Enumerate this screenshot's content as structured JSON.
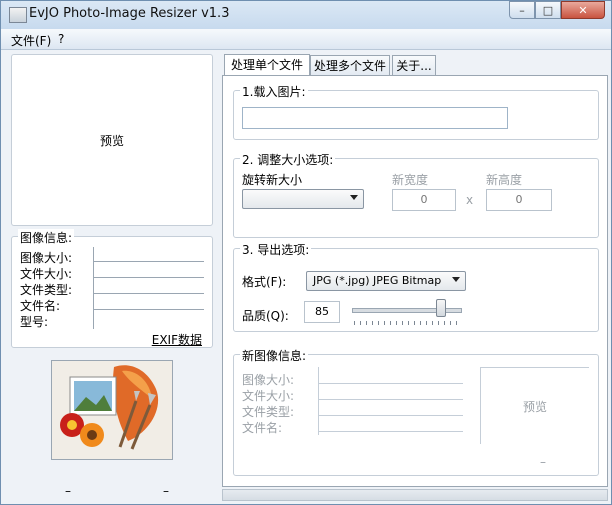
{
  "window": {
    "title": "EvJO Photo-Image Resizer v1.3",
    "controls": {
      "minimize": "–",
      "maximize": "□",
      "close": "✕"
    }
  },
  "menu": {
    "items": [
      "文件(F)",
      "?"
    ]
  },
  "left": {
    "preview_label": "预览",
    "info_title": "图像信息:",
    "info_labels": [
      "图像大小:",
      "文件大小:",
      "文件类型:",
      "文件名:",
      "型号:"
    ],
    "exif_link": "EXIF数据",
    "footer_left": "–",
    "footer_right": "–"
  },
  "tabs": [
    "处理单个文件",
    "处理多个文件",
    "关于..."
  ],
  "load": {
    "title": "1.载入图片:",
    "path_value": ""
  },
  "resize": {
    "title": "2. 调整大小选项:",
    "rotate_label": "旋转新大小",
    "rotate_value": "",
    "width_label": "新宽度",
    "height_label": "新高度",
    "width_value": "0",
    "height_value": "0",
    "x": "x"
  },
  "export": {
    "title": "3. 导出选项:",
    "format_label": "格式(F):",
    "format_value": "JPG (*.jpg) JPEG Bitmap",
    "quality_label": "品质(Q):",
    "quality_value": "85"
  },
  "newinfo": {
    "title": "新图像信息:",
    "labels": [
      "图像大小:",
      "文件大小:",
      "文件类型:",
      "文件名:"
    ],
    "preview_label": "预览",
    "dash": "–"
  },
  "colors": {
    "accent": "#6f8fb0",
    "close": "#c9543f"
  }
}
